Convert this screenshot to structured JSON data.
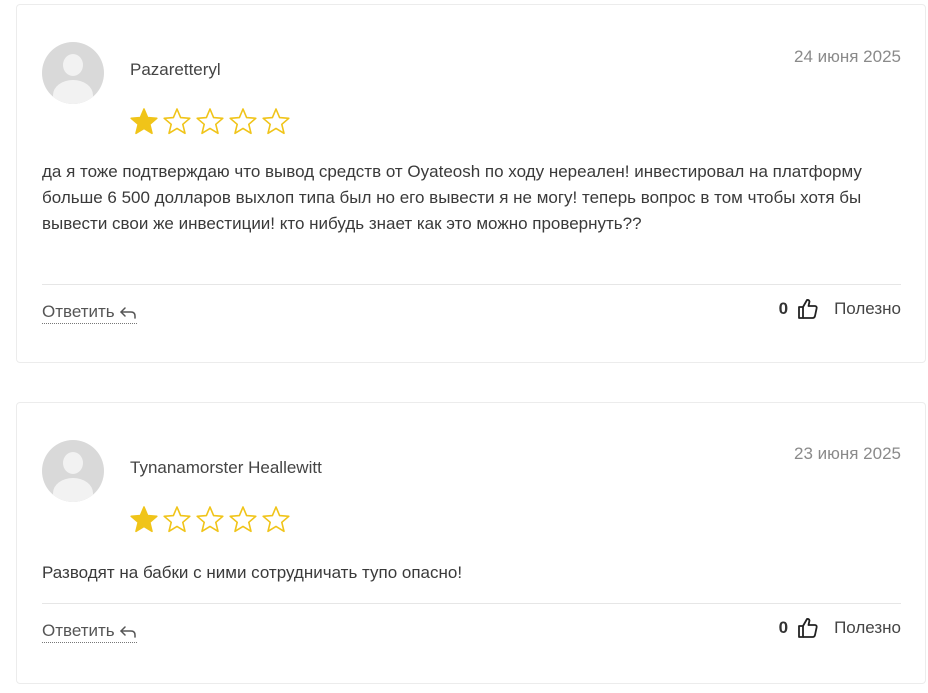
{
  "reviews": [
    {
      "author": "Pazaretteryl",
      "date": "24 июня 2025",
      "rating": 1,
      "max_rating": 5,
      "text": "да я тоже подтверждаю что вывод средств от Oyateosh по ходу нереален! инвестировал на платформу больше 6 500 долларов выхлоп типа был но его вывести я не могу! теперь вопрос в том чтобы хотя бы вывести свои же инвестиции! кто нибудь знает как это можно провернуть??",
      "reply_label": "Ответить",
      "useful_count": "0",
      "useful_label": "Полезно"
    },
    {
      "author": "Tynanamorster Heallewitt",
      "date": "23 июня 2025",
      "rating": 1,
      "max_rating": 5,
      "text": "Разводят на бабки с ними сотрудничать тупо опасно!",
      "reply_label": "Ответить",
      "useful_count": "0",
      "useful_label": "Полезно"
    }
  ],
  "colors": {
    "star_filled": "#f0c419",
    "star_outline": "#f0c419",
    "avatar_bg": "#d9d9d9"
  },
  "icons": {
    "reply": "reply-arrow-icon",
    "thumb": "thumbs-up-icon",
    "star": "star-icon"
  }
}
